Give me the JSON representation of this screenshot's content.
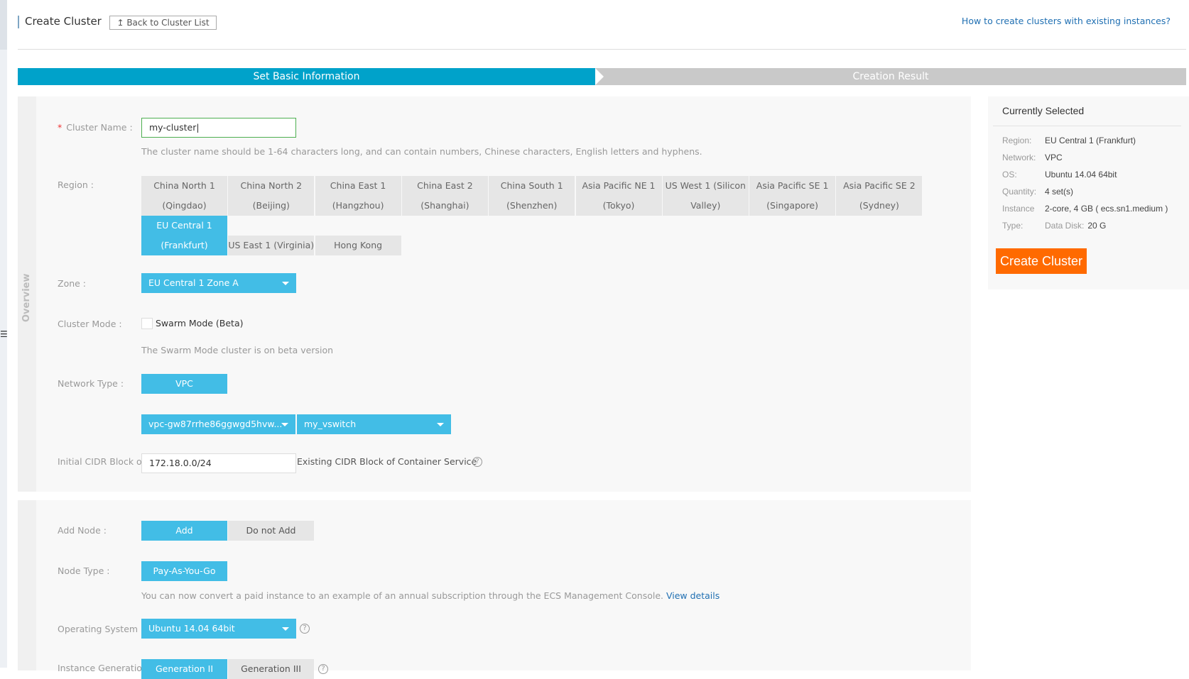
{
  "header": {
    "title": "Create Cluster",
    "back_label": "Back to Cluster List",
    "help_link": "How to create clusters with existing instances?"
  },
  "steps": [
    "Set Basic Information",
    "Creation Result"
  ],
  "sidebar": {
    "overview_label": "Overview"
  },
  "form": {
    "cluster_name": {
      "label": "Cluster Name :",
      "value": "my-cluster",
      "hint": "The cluster name should be 1-64 characters long, and can contain numbers, Chinese characters, English letters and hyphens."
    },
    "region": {
      "label": "Region :",
      "options": [
        {
          "l1": "China North 1",
          "l2": "(Qingdao)"
        },
        {
          "l1": "China North 2",
          "l2": "(Beijing)"
        },
        {
          "l1": "China East 1",
          "l2": "(Hangzhou)"
        },
        {
          "l1": "China East 2",
          "l2": "(Shanghai)"
        },
        {
          "l1": "China South 1",
          "l2": "(Shenzhen)"
        },
        {
          "l1": "Asia Pacific NE 1",
          "l2": "(Tokyo)"
        },
        {
          "l1": "US West 1 (Silicon",
          "l2": "Valley)"
        },
        {
          "l1": "Asia Pacific SE 1",
          "l2": "(Singapore)"
        },
        {
          "l1": "Asia Pacific SE 2",
          "l2": "(Sydney)"
        },
        {
          "l1": "EU Central 1",
          "l2": "(Frankfurt)"
        },
        {
          "l1": "US East 1 (Virginia)",
          "l2": ""
        },
        {
          "l1": "Hong Kong",
          "l2": ""
        }
      ],
      "selected": "EU Central 1 (Frankfurt)"
    },
    "zone": {
      "label": "Zone :",
      "value": "EU Central 1 Zone A"
    },
    "cluster_mode": {
      "label": "Cluster Mode :",
      "checkbox": "Swarm Mode (Beta)",
      "checked": false,
      "hint": "The Swarm Mode cluster is on beta version"
    },
    "network_type": {
      "label": "Network Type :",
      "value": "VPC",
      "vpc": "vpc-gw87rrhe86ggwgd5hvw...",
      "vswitch": "my_vswitch"
    },
    "cidr": {
      "label": "Initial CIDR Block of",
      "value": "172.18.0.0/24",
      "suffix": "Existing CIDR Block of Container Service"
    },
    "add_node": {
      "label": "Add Node :",
      "options": [
        "Add",
        "Do not Add"
      ],
      "selected": "Add"
    },
    "node_type": {
      "label": "Node Type :",
      "value": "Pay-As-You-Go",
      "hint": "You can now convert a paid instance to an example of an annual subscription through the ECS Management Console.",
      "hint_link": "View details"
    },
    "os": {
      "label": "Operating System :",
      "value": "Ubuntu 14.04 64bit"
    },
    "instance_generation": {
      "label": "Instance Generation :",
      "options": [
        "Generation II",
        "Generation III"
      ],
      "selected": "Generation II"
    }
  },
  "summary": {
    "title": "Currently Selected",
    "rows": [
      {
        "k": "Region:",
        "v": "EU Central 1 (Frankfurt)"
      },
      {
        "k": "Network:",
        "v": "VPC"
      },
      {
        "k": "OS:",
        "v": "Ubuntu 14.04 64bit"
      },
      {
        "k": "Quantity:",
        "v": "4 set(s)"
      },
      {
        "k": "Instance",
        "v": "2-core, 4 GB ( ecs.sn1.medium )"
      },
      {
        "k": "Type:",
        "v": "Data Disk:",
        "v2": "20 G"
      }
    ],
    "create_label": "Create Cluster",
    "create_color": "#ff6a00"
  }
}
